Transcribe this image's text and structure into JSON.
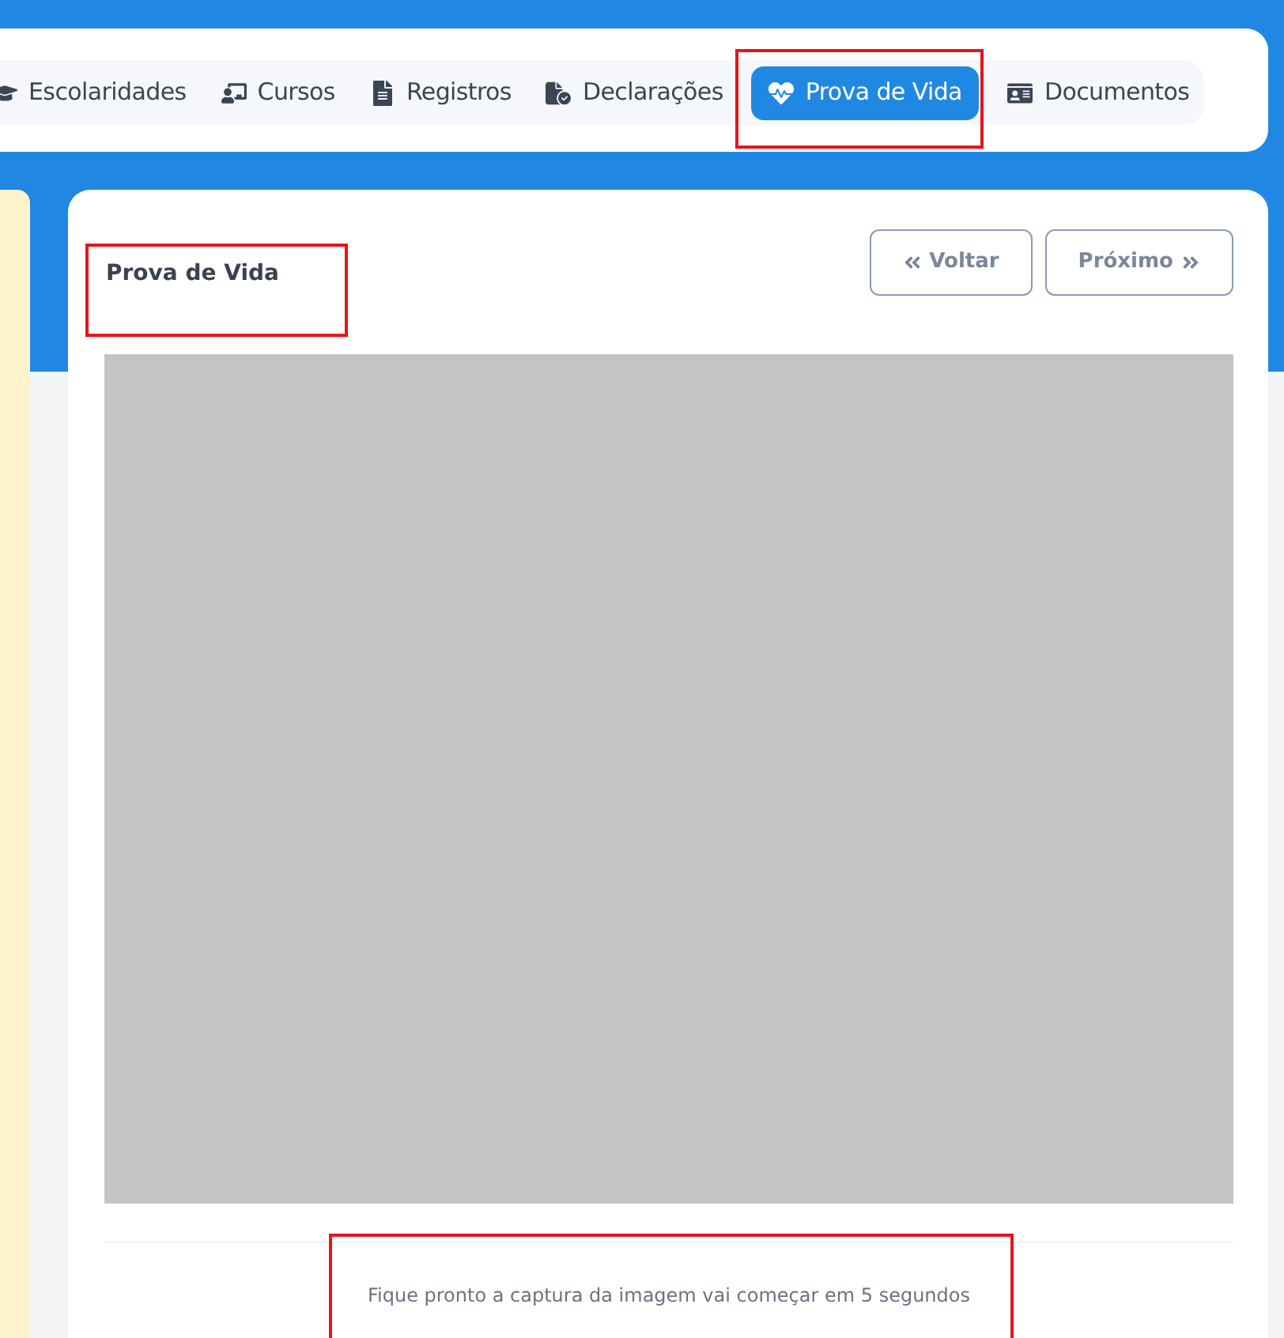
{
  "tabs": [
    {
      "kind": "school",
      "label": "Escolaridades",
      "selected": false,
      "highlighted": false
    },
    {
      "kind": "course",
      "label": "Cursos",
      "selected": false,
      "highlighted": false
    },
    {
      "kind": "record",
      "label": "Registros",
      "selected": false,
      "highlighted": false
    },
    {
      "kind": "declaration",
      "label": "Declarações",
      "selected": false,
      "highlighted": false
    },
    {
      "kind": "proof",
      "label": "Prova de Vida",
      "selected": true,
      "highlighted": true
    },
    {
      "kind": "document",
      "label": "Documentos",
      "selected": false,
      "highlighted": false
    }
  ],
  "panel": {
    "title": "Prova de Vida",
    "title_highlighted": true,
    "buttons": [
      {
        "kind": "back",
        "label": "Voltar"
      },
      {
        "kind": "next",
        "label": "Próximo"
      }
    ],
    "message": "Fique pronto a captura da imagem vai começar em 5 segundos",
    "message_highlighted": true
  }
}
